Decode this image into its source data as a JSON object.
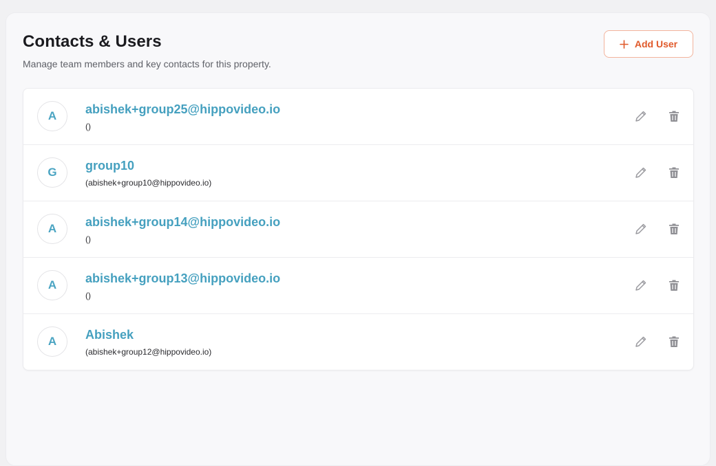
{
  "header": {
    "title": "Contacts & Users",
    "subtitle": "Manage team members and key contacts for this property.",
    "add_button_label": "Add User",
    "add_icon": "plus-icon"
  },
  "colors": {
    "accent": "#e0592a",
    "link": "#45a0bf",
    "icon_gray": "#9a9a9f"
  },
  "users": [
    {
      "initial": "A",
      "name": "abishek+group25@hippovideo.io",
      "detail": "()"
    },
    {
      "initial": "G",
      "name": "group10",
      "detail": "(abishek+group10@hippovideo.io)"
    },
    {
      "initial": "A",
      "name": "abishek+group14@hippovideo.io",
      "detail": "()"
    },
    {
      "initial": "A",
      "name": "abishek+group13@hippovideo.io",
      "detail": "()"
    },
    {
      "initial": "A",
      "name": "Abishek",
      "detail": "(abishek+group12@hippovideo.io)"
    }
  ],
  "row_actions": {
    "edit_icon": "pencil-icon",
    "delete_icon": "trash-icon"
  }
}
